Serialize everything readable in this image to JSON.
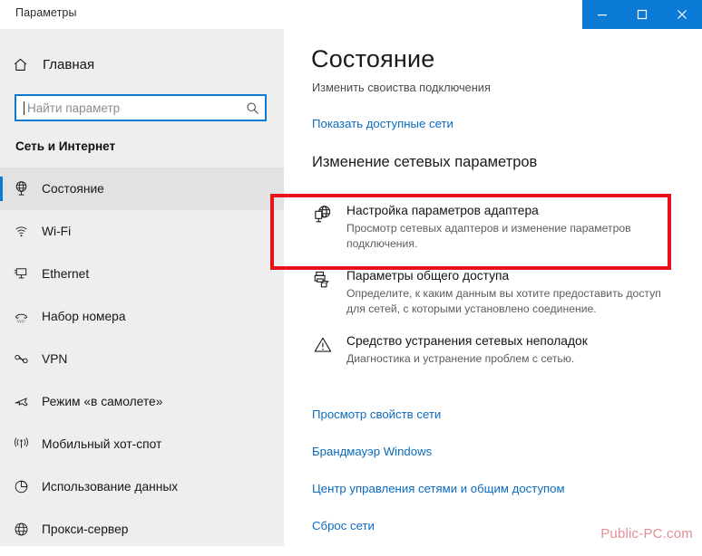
{
  "window": {
    "title": "Параметры",
    "controls": [
      {
        "name": "minimize",
        "glyph": "minimize-icon"
      },
      {
        "name": "maximize",
        "glyph": "maximize-icon"
      },
      {
        "name": "close",
        "glyph": "close-icon"
      }
    ],
    "accent_color": "#0b7ad4"
  },
  "sidebar": {
    "home": {
      "label": "Главная",
      "icon": "home-icon"
    },
    "search": {
      "value": "",
      "placeholder": "Найти параметр",
      "icon": "search-icon"
    },
    "section_title": "Сеть и Интернет",
    "items": [
      {
        "label": "Состояние",
        "icon": "network-status-icon",
        "selected": true
      },
      {
        "label": "Wi-Fi",
        "icon": "wifi-icon",
        "selected": false
      },
      {
        "label": "Ethernet",
        "icon": "ethernet-icon",
        "selected": false
      },
      {
        "label": "Набор номера",
        "icon": "dialup-icon",
        "selected": false
      },
      {
        "label": "VPN",
        "icon": "vpn-icon",
        "selected": false
      },
      {
        "label": "Режим «в самолете»",
        "icon": "airplane-icon",
        "selected": false
      },
      {
        "label": "Мобильный хот-спот",
        "icon": "hotspot-icon",
        "selected": false
      },
      {
        "label": "Использование данных",
        "icon": "data-usage-icon",
        "selected": false
      },
      {
        "label": "Прокси-сервер",
        "icon": "proxy-globe-icon",
        "selected": false
      }
    ]
  },
  "main": {
    "title": "Состояние",
    "subtitle": "Изменить своиства подключения",
    "top_link": "Показать доступные сети",
    "group_heading": "Изменение сетевых параметров",
    "settings": [
      {
        "name": "Настройка параметров адаптера",
        "desc": "Просмотр сетевых адаптеров и изменение параметров подключения.",
        "icon": "adapter-globe-icon",
        "highlighted": true
      },
      {
        "name": "Параметры общего доступа",
        "desc": "Определите, к каким данным вы хотите предоставить доступ для сетей, с которыми установлено соединение.",
        "icon": "sharing-icon",
        "highlighted": false
      },
      {
        "name": "Средство устранения сетевых неполадок",
        "desc": "Диагностика и устранение проблем с сетью.",
        "icon": "warning-triangle-icon",
        "highlighted": false
      }
    ],
    "links": [
      "Просмотр свойств сети",
      "Брандмауэр Windows",
      "Центр управления сетями и общим доступом",
      "Сброс сети"
    ]
  },
  "annotation": {
    "highlight_color": "#e8131a"
  },
  "watermark": "Public-PC.com"
}
